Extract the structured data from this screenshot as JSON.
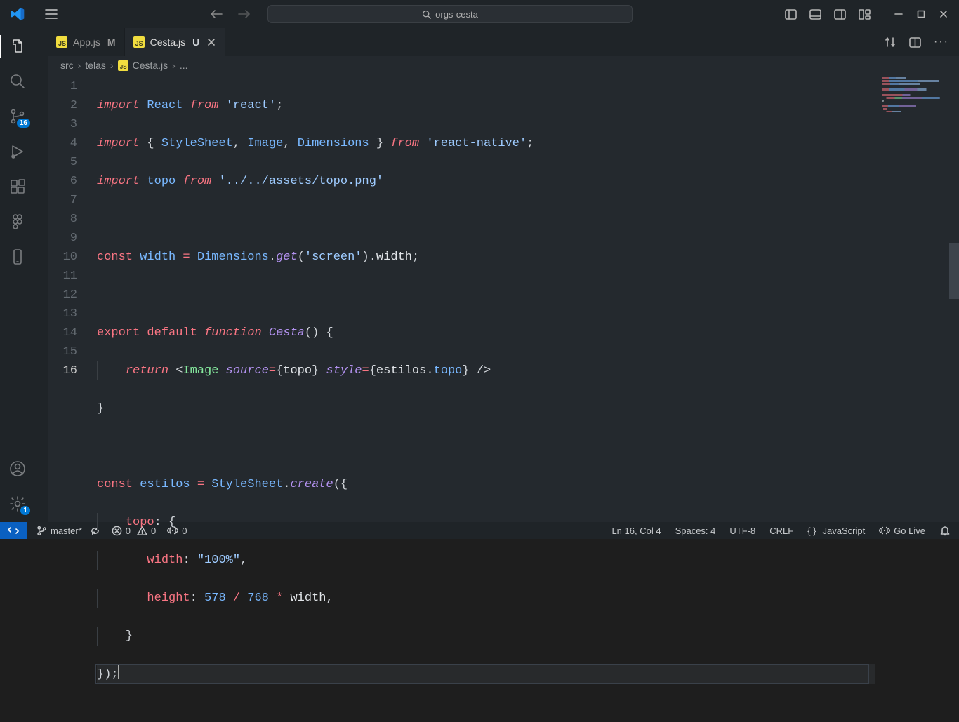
{
  "search": {
    "text": "orgs-cesta"
  },
  "scm_badge": "16",
  "settings_badge": "1",
  "tabs": [
    {
      "icon": "JS",
      "label": "App.js",
      "status": "M",
      "active": false
    },
    {
      "icon": "JS",
      "label": "Cesta.js",
      "status": "U",
      "active": true
    }
  ],
  "breadcrumbs": {
    "seg1": "src",
    "seg2": "telas",
    "seg3": "Cesta.js",
    "seg4": "..."
  },
  "code": {
    "lines": [
      "1",
      "2",
      "3",
      "4",
      "5",
      "6",
      "7",
      "8",
      "9",
      "10",
      "11",
      "12",
      "13",
      "14",
      "15",
      "16"
    ],
    "l1": {
      "kw": "import",
      "id": "React",
      "from": "from",
      "str": "'react'",
      "semi": ";"
    },
    "l2": {
      "kw": "import",
      "ob": "{ ",
      "a": "StyleSheet",
      "c1": ", ",
      "b": "Image",
      "c2": ", ",
      "c": "Dimensions",
      "cb": " }",
      "from": "from",
      "str": "'react-native'",
      "semi": ";"
    },
    "l3": {
      "kw": "import",
      "id": "topo",
      "from": "from",
      "str": "'../../assets/topo.png'"
    },
    "l5": {
      "const": "const",
      "name": "width",
      "eq": " = ",
      "cls": "Dimensions",
      "dot1": ".",
      "fn": "get",
      "op": "(",
      "arg": "'screen'",
      "cp": ")",
      "dot2": ".",
      "prop": "width",
      "semi": ";"
    },
    "l7": {
      "exp": "export",
      "def": "default",
      "fun": "function",
      "name": "Cesta",
      "par": "() {",
      "parOpen": "()",
      "brace": " {"
    },
    "l8": {
      "ret": "return",
      "lt": " <",
      "tag": "Image",
      "sp": " ",
      "a1": "source",
      "eq1": "=",
      "ob1": "{",
      "v1": "topo",
      "cb1": "}",
      "a2": "style",
      "eq2": "=",
      "ob2": "{",
      "v2a": "estilos",
      "dot": ".",
      "v2b": "topo",
      "cb2": "}",
      "close": " />"
    },
    "l9": {
      "brace": "}"
    },
    "l11": {
      "const": "const",
      "name": "estilos",
      "eq": " = ",
      "cls": "StyleSheet",
      "dot": ".",
      "fn": "create",
      "op": "(",
      "ob": "{"
    },
    "l12": {
      "key": "topo",
      "colon": ": {",
      "open": ""
    },
    "l13": {
      "key": "width",
      "colon": ": ",
      "val": "\"100%\"",
      "comma": ","
    },
    "l14": {
      "key": "height",
      "colon": ": ",
      "n1": "578",
      "op1": " / ",
      "n2": "768",
      "op2": " * ",
      "id": "width",
      "comma": ","
    },
    "l15": {
      "brace": "}"
    },
    "l16": {
      "close": "});"
    }
  },
  "status": {
    "branch": "master*",
    "sync": "",
    "errors": "0",
    "warnings": "0",
    "ports_num": "0",
    "lncol": "Ln 16, Col 4",
    "spaces": "Spaces: 4",
    "encoding": "UTF-8",
    "eol": "CRLF",
    "lang": "JavaScript",
    "golive": "Go Live"
  }
}
